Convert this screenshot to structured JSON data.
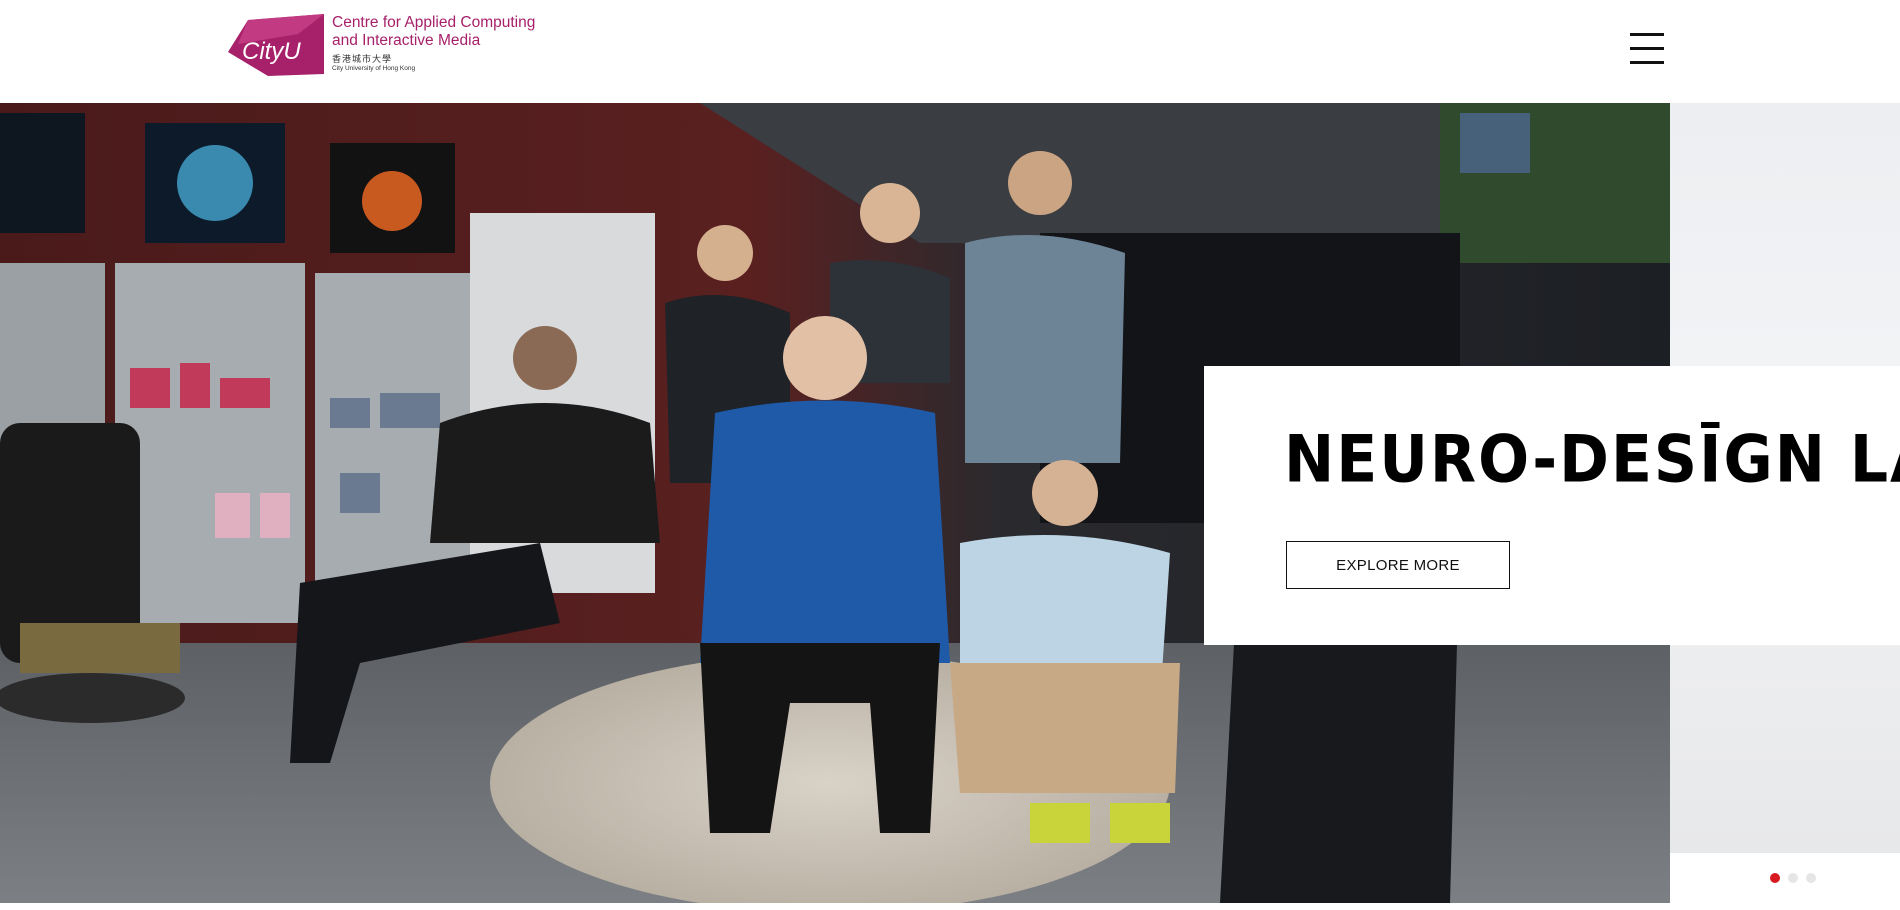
{
  "header": {
    "logo": {
      "mark_text": "CityU",
      "line1": "Centre for Applied Computing",
      "line2": "and Interactive Media",
      "chinese": "香港城市大學",
      "english_small": "City University of Hong Kong",
      "brand_color": "#a7206a"
    },
    "menu_icon": "hamburger-menu-icon"
  },
  "hero": {
    "title": "NEURO-DESĪGN LAB",
    "button_label": "EXPLORE MORE",
    "slides": 3,
    "active_slide": 1,
    "active_dot_color": "#d71920"
  }
}
